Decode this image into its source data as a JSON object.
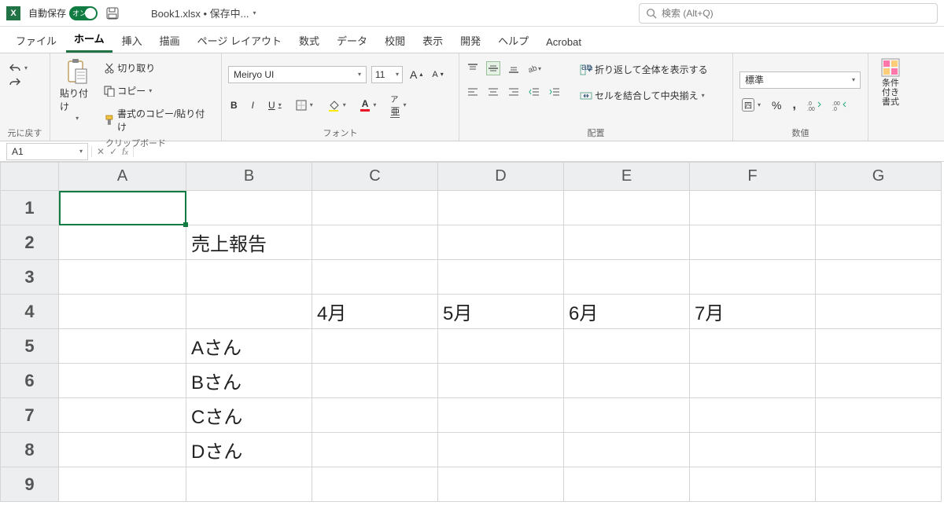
{
  "title": {
    "autosave_label": "自動保存",
    "toggle_text": "オン",
    "filename": "Book1.xlsx • 保存中...",
    "search_placeholder": "検索 (Alt+Q)"
  },
  "tabs": {
    "file": "ファイル",
    "home": "ホーム",
    "insert": "挿入",
    "draw": "描画",
    "layout": "ページ レイアウト",
    "formulas": "数式",
    "data": "データ",
    "review": "校閲",
    "view": "表示",
    "dev": "開発",
    "help": "ヘルプ",
    "acrobat": "Acrobat"
  },
  "ribbon": {
    "undo_group": "元に戻す",
    "clipboard_group": "クリップボード",
    "paste": "貼り付け",
    "cut": "切り取り",
    "copy": "コピー",
    "format_painter": "書式のコピー/貼り付け",
    "font_group": "フォント",
    "font_name": "Meiryo UI",
    "font_size": "11",
    "align_group": "配置",
    "wrap": "折り返して全体を表示する",
    "merge": "セルを結合して中央揃え",
    "number_group": "数値",
    "number_format": "標準",
    "cond_fmt": "条件付き書式"
  },
  "namebox": "A1",
  "columns": [
    "A",
    "B",
    "C",
    "D",
    "E",
    "F",
    "G"
  ],
  "rows": [
    "1",
    "2",
    "3",
    "4",
    "5",
    "6",
    "7",
    "8",
    "9"
  ],
  "cells": {
    "B2": "売上報告",
    "C4": "4月",
    "D4": "5月",
    "E4": "6月",
    "F4": "7月",
    "B5": "Aさん",
    "B6": "Bさん",
    "B7": "Cさん",
    "B8": "Dさん"
  }
}
